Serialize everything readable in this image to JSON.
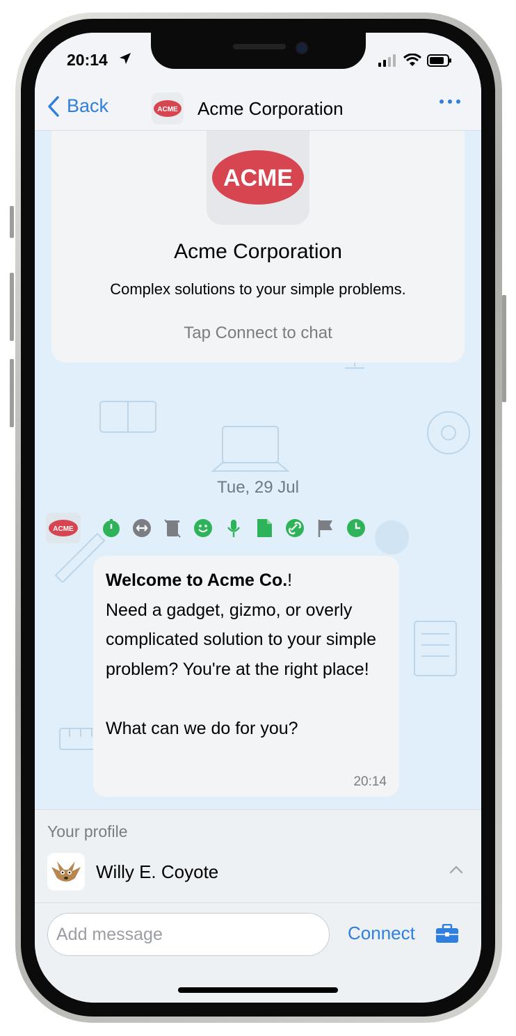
{
  "status_bar": {
    "time": "20:14"
  },
  "nav": {
    "back_label": "Back",
    "title": "Acme Corporation",
    "logo_text": "ACME"
  },
  "info_card": {
    "logo_text": "ACME",
    "name": "Acme Corporation",
    "description": "Complex solutions to your simple problems.",
    "hint": "Tap Connect to chat"
  },
  "chat": {
    "date": "Tue, 29 Jul",
    "sender_logo_text": "ACME",
    "feature_icons": [
      "timer-icon",
      "swap-icon",
      "trash-icon",
      "smile-icon",
      "mic-icon",
      "document-icon",
      "link-icon",
      "flag-icon",
      "clock-icon"
    ],
    "message": {
      "bold": "Welcome to Acme Co.",
      "rest": "!\nNeed a gadget, gizmo, or overly complicated solution to your simple problem? You're at the right place!\n\nWhat can we do for you?",
      "time": "20:14"
    }
  },
  "profile": {
    "label": "Your profile",
    "name": "Willy E. Coyote"
  },
  "composer": {
    "placeholder": "Add message",
    "connect_label": "Connect"
  },
  "colors": {
    "accent": "#2f7fde",
    "acme_red": "#d64550",
    "feature_green": "#2fb35a"
  }
}
